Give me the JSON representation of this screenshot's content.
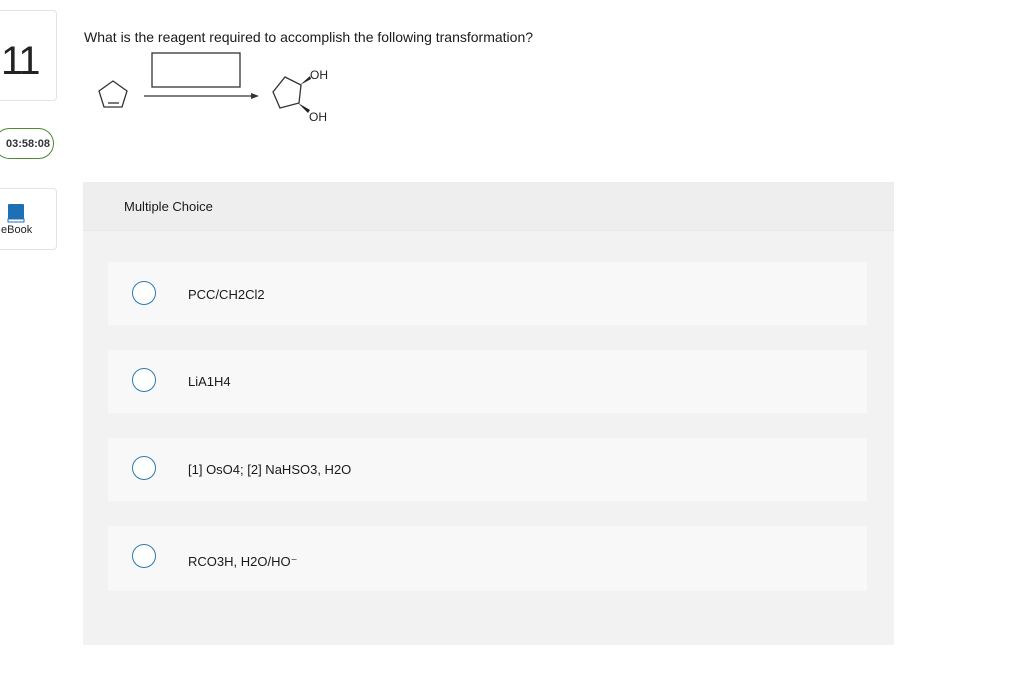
{
  "sidebar": {
    "question_number": "11",
    "timer": "03:58:08",
    "ebook_label": "eBook"
  },
  "question": {
    "text": "What is the reagent required to accomplish the following transformation?",
    "product_labels": {
      "oh_top": "OH",
      "oh_bottom": "OH"
    }
  },
  "multiple_choice": {
    "title": "Multiple Choice",
    "options": [
      {
        "label": "PCC/CH2Cl2"
      },
      {
        "label": "LiA1H4"
      },
      {
        "label": "[1] OsO4; [2] NaHSO3, H2O"
      },
      {
        "label": "RCO3H, H2O/HO⁻"
      }
    ]
  },
  "colors": {
    "radio_border": "#2a7ab8",
    "timer_border": "#4a8a3a",
    "ebook_icon": "#1f6fb5",
    "panel_bg": "#f2f2f2",
    "option_bg": "#f8f8f8"
  },
  "icons": {
    "ebook": "book-icon"
  }
}
